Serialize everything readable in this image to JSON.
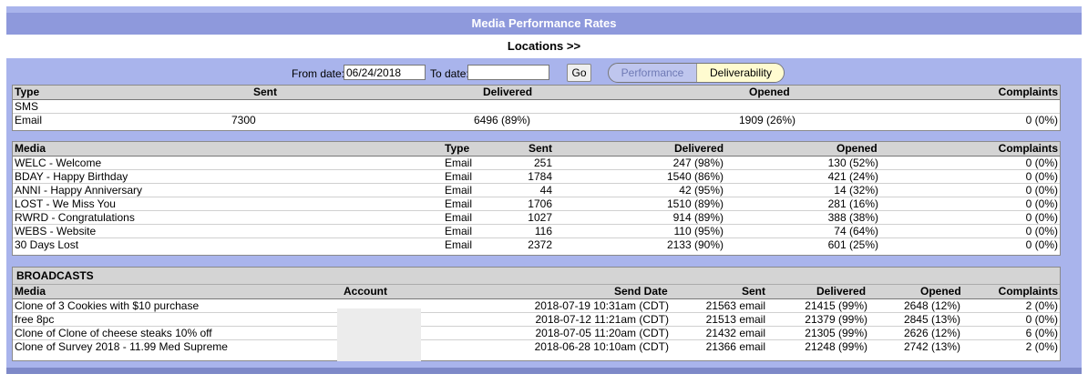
{
  "title": "Media Performance Rates",
  "locations_link": "Locations >>",
  "filter": {
    "from_label": "From date:",
    "from_value": "06/24/2018",
    "to_label": "To date:",
    "to_value": "",
    "go_label": "Go",
    "toggle_performance": "Performance",
    "toggle_deliverability": "Deliverability"
  },
  "summary": {
    "headers": {
      "type": "Type",
      "sent": "Sent",
      "delivered": "Delivered",
      "opened": "Opened",
      "complaints": "Complaints"
    },
    "rows": [
      {
        "type": "SMS",
        "sent": "",
        "delivered": "",
        "opened": "",
        "complaints": ""
      },
      {
        "type": "Email",
        "sent": "7300",
        "delivered": "6496 (89%)",
        "opened": "1909 (26%)",
        "complaints": "0 (0%)"
      }
    ]
  },
  "media": {
    "headers": {
      "media": "Media",
      "type": "Type",
      "sent": "Sent",
      "delivered": "Delivered",
      "opened": "Opened",
      "complaints": "Complaints"
    },
    "rows": [
      {
        "media": "WELC - Welcome",
        "type": "Email",
        "sent": "251",
        "delivered": "247 (98%)",
        "opened": "130 (52%)",
        "complaints": "0 (0%)"
      },
      {
        "media": "BDAY - Happy Birthday",
        "type": "Email",
        "sent": "1784",
        "delivered": "1540 (86%)",
        "opened": "421 (24%)",
        "complaints": "0 (0%)"
      },
      {
        "media": "ANNI - Happy Anniversary",
        "type": "Email",
        "sent": "44",
        "delivered": "42 (95%)",
        "opened": "14 (32%)",
        "complaints": "0 (0%)"
      },
      {
        "media": "LOST - We Miss You",
        "type": "Email",
        "sent": "1706",
        "delivered": "1510 (89%)",
        "opened": "281 (16%)",
        "complaints": "0 (0%)"
      },
      {
        "media": "RWRD - Congratulations",
        "type": "Email",
        "sent": "1027",
        "delivered": "914 (89%)",
        "opened": "388 (38%)",
        "complaints": "0 (0%)"
      },
      {
        "media": "WEBS - Website",
        "type": "Email",
        "sent": "116",
        "delivered": "110 (95%)",
        "opened": "74 (64%)",
        "complaints": "0 (0%)"
      },
      {
        "media": "30 Days Lost",
        "type": "Email",
        "sent": "2372",
        "delivered": "2133 (90%)",
        "opened": "601 (25%)",
        "complaints": "0 (0%)"
      }
    ]
  },
  "broadcasts": {
    "section_title": "BROADCASTS",
    "headers": {
      "media": "Media",
      "account": "Account",
      "send_date": "Send Date",
      "sent": "Sent",
      "delivered": "Delivered",
      "opened": "Opened",
      "complaints": "Complaints"
    },
    "rows": [
      {
        "media": "Clone of 3 Cookies with $10 purchase",
        "account": "",
        "send_date": "2018-07-19 10:31am (CDT)",
        "sent": "21563 email",
        "delivered": "21415 (99%)",
        "opened": "2648 (12%)",
        "complaints": "2 (0%)"
      },
      {
        "media": "free 8pc",
        "account": "",
        "send_date": "2018-07-12 11:21am (CDT)",
        "sent": "21513 email",
        "delivered": "21379 (99%)",
        "opened": "2845 (13%)",
        "complaints": "0 (0%)"
      },
      {
        "media": "Clone of Clone of cheese steaks 10% off",
        "account": "",
        "send_date": "2018-07-05 11:20am (CDT)",
        "sent": "21432 email",
        "delivered": "21305 (99%)",
        "opened": "2626 (12%)",
        "complaints": "6 (0%)"
      },
      {
        "media": "Clone of Survey 2018 - 11.99 Med Supreme",
        "account": "",
        "send_date": "2018-06-28 10:10am (CDT)",
        "sent": "21366 email",
        "delivered": "21248 (99%)",
        "opened": "2742 (13%)",
        "complaints": "2 (0%)"
      }
    ]
  }
}
